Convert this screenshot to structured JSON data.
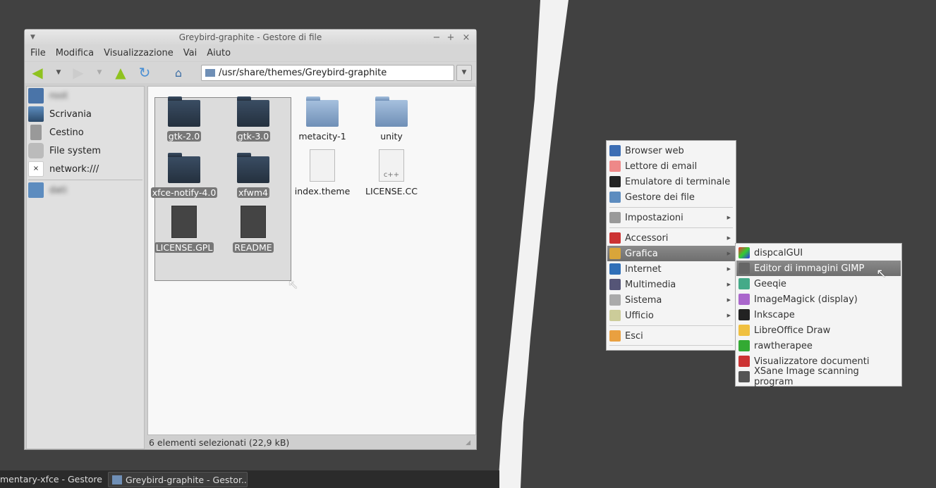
{
  "window": {
    "title": "Greybird-graphite - Gestore di file",
    "controls": [
      "−",
      "+",
      "×"
    ]
  },
  "menubar": [
    "File",
    "Modifica",
    "Visualizzazione",
    "Vai",
    "Aiuto"
  ],
  "address": "/usr/share/themes/Greybird-graphite",
  "sidebar": [
    {
      "label": "root",
      "blurred": true
    },
    {
      "label": "Scrivania"
    },
    {
      "label": "Cestino"
    },
    {
      "label": "File system"
    },
    {
      "label": "network:///"
    },
    {
      "label": "dati",
      "blurred": true
    }
  ],
  "files": [
    {
      "name": "gtk-2.0",
      "type": "folder",
      "selected": true
    },
    {
      "name": "gtk-3.0",
      "type": "folder",
      "selected": true
    },
    {
      "name": "metacity-1",
      "type": "folder"
    },
    {
      "name": "unity",
      "type": "folder"
    },
    {
      "name": "xfce-notify-4.0",
      "type": "folder",
      "selected": true
    },
    {
      "name": "xfwm4",
      "type": "folder",
      "selected": true
    },
    {
      "name": "index.theme",
      "type": "theme"
    },
    {
      "name": "LICENSE.CC",
      "type": "code",
      "icon_text": "c++"
    },
    {
      "name": "LICENSE.GPL",
      "type": "text",
      "selected": true
    },
    {
      "name": "README",
      "type": "text",
      "selected": true
    }
  ],
  "status": "6 elementi selezionati (22,9 kB)",
  "taskbar": [
    "mentary-xfce - Gestore ...",
    "Greybird-graphite - Gestor..."
  ],
  "app_menu": {
    "items": [
      "Browser web",
      "Lettore di email",
      "Emulatore di terminale",
      "Gestore dei file",
      "Impostazioni",
      "Accessori",
      "Grafica",
      "Internet",
      "Multimedia",
      "Sistema",
      "Ufficio",
      "Esci"
    ],
    "highlighted": "Grafica"
  },
  "submenu": {
    "items": [
      "dispcalGUI",
      "Editor di immagini GIMP",
      "Geeqie",
      "ImageMagick (display)",
      "Inkscape",
      "LibreOffice Draw",
      "rawtherapee",
      "Visualizzatore documenti",
      "XSane Image scanning program"
    ],
    "highlighted": "Editor di immagini GIMP"
  }
}
